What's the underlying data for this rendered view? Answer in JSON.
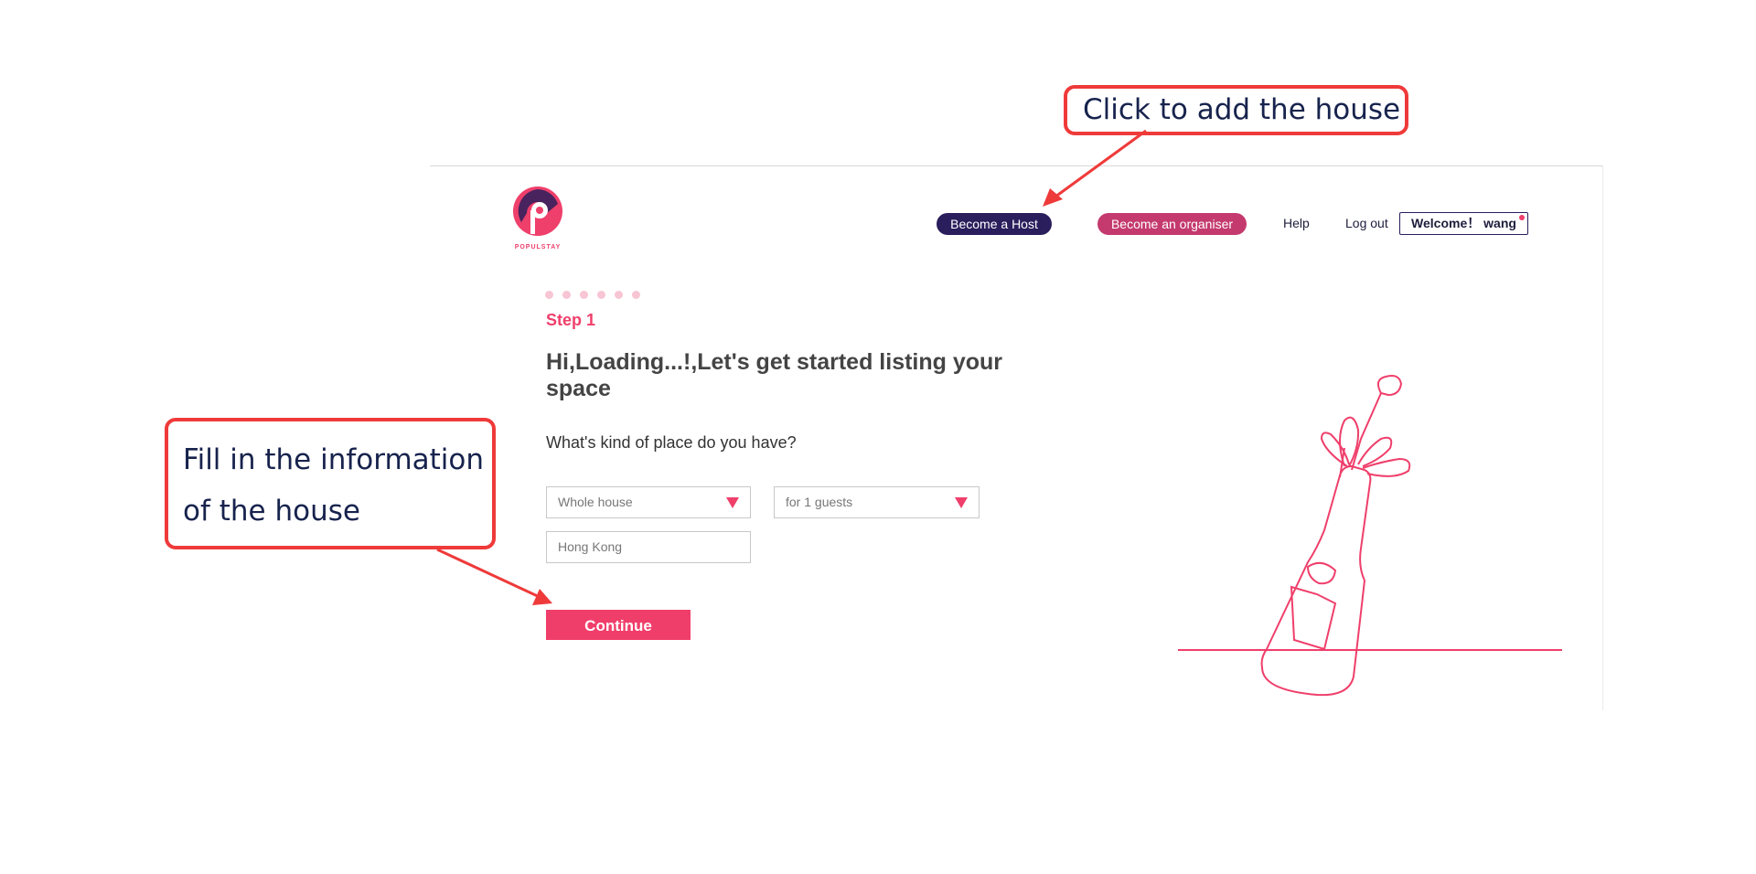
{
  "brand": {
    "name": "POPULSTAY",
    "color": "#ef3f6b"
  },
  "nav": {
    "become_host": "Become a Host",
    "become_organiser": "Become an organiser",
    "help": "Help",
    "logout": "Log out",
    "welcome": "Welcome！ wang"
  },
  "progress": {
    "total_steps": 6
  },
  "form": {
    "step_label": "Step 1",
    "heading": "Hi,Loading...!,Let's get started listing your space",
    "question": "What's kind of place do you have?",
    "place_type": "Whole house",
    "guests": "for 1 guests",
    "city": "Hong Kong",
    "continue": "Continue"
  },
  "annotations": {
    "host_callout": "Click to add the house",
    "fill_callout": "Fill in the information of the house"
  },
  "colors": {
    "accent": "#ef3f6b",
    "host_button": "#2a1e5c",
    "organiser_button": "#c43a6e",
    "annotation": "#ef3a3a"
  }
}
